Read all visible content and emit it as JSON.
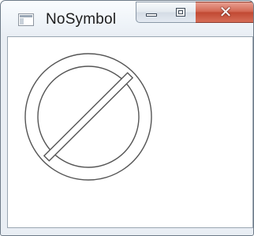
{
  "window": {
    "title": "NoSymbol",
    "icon": "app-window-icon",
    "controls": {
      "minimize_icon": "minimize-icon",
      "maximize_icon": "maximize-icon",
      "close_icon": "close-icon",
      "close_glyph": "✕",
      "close_color": "#c9503a"
    }
  },
  "content": {
    "symbol": "no-symbol-icon",
    "stroke_color": "#555555",
    "fill_color": "#ffffff"
  }
}
